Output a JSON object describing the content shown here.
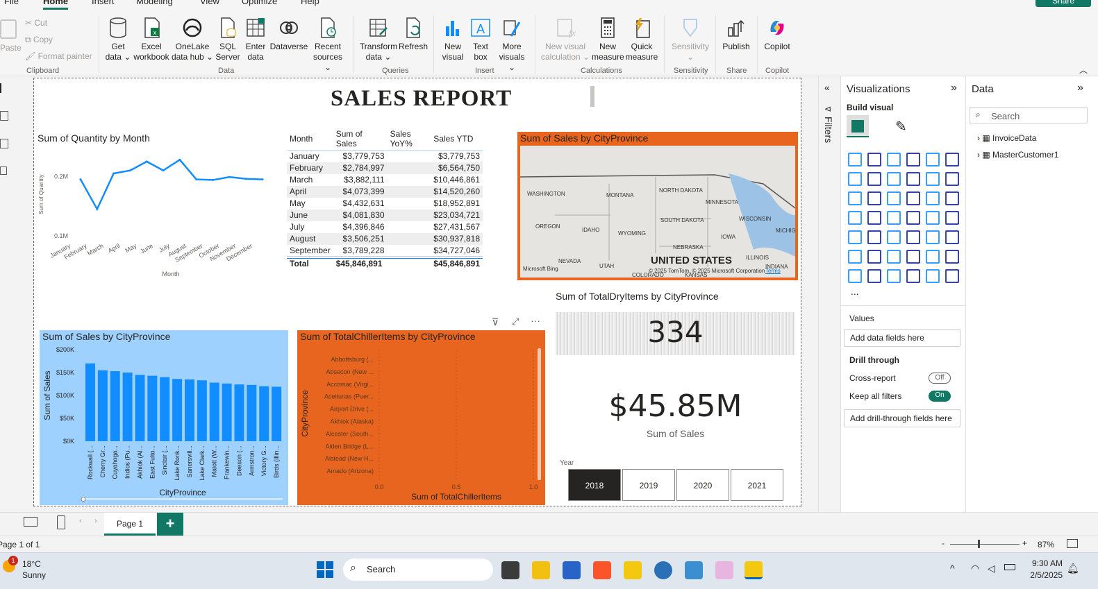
{
  "ribbon": {
    "tabs": [
      "File",
      "Home",
      "Insert",
      "Modeling",
      "View",
      "Optimize",
      "Help"
    ],
    "share": "Share",
    "clipboard": {
      "paste": "Paste",
      "cut": "Cut",
      "copy": "Copy",
      "format_painter": "Format painter",
      "group": "Clipboard"
    },
    "data_buttons": [
      {
        "l1": "Get",
        "l2": "data ⌄"
      },
      {
        "l1": "Excel",
        "l2": "workbook"
      },
      {
        "l1": "OneLake",
        "l2": "data hub ⌄"
      },
      {
        "l1": "SQL",
        "l2": "Server"
      },
      {
        "l1": "Enter",
        "l2": "data"
      },
      {
        "l1": "Dataverse",
        "l2": ""
      },
      {
        "l1": "Recent",
        "l2": "sources ⌄"
      }
    ],
    "data_group": "Data",
    "queries": [
      {
        "l1": "Transform",
        "l2": "data ⌄"
      },
      {
        "l1": "Refresh",
        "l2": ""
      }
    ],
    "queries_group": "Queries",
    "insert": [
      {
        "l1": "New",
        "l2": "visual"
      },
      {
        "l1": "Text",
        "l2": "box"
      },
      {
        "l1": "More",
        "l2": "visuals ⌄"
      }
    ],
    "insert_group": "Insert",
    "calculations": [
      {
        "l1": "New visual",
        "l2": "calculation ⌄"
      },
      {
        "l1": "New",
        "l2": "measure"
      },
      {
        "l1": "Quick",
        "l2": "measure"
      }
    ],
    "calculations_group": "Calculations",
    "sensitivity": {
      "l1": "Sensitivity",
      "l2": "⌄",
      "group": "Sensitivity"
    },
    "share_grp": {
      "l1": "Publish",
      "group": "Share"
    },
    "copilot": {
      "l1": "Copilot",
      "group": "Copilot"
    }
  },
  "report": {
    "title": "SALES REPORT",
    "line_chart_title": "Sum of Quantity by Month",
    "table": {
      "headers": [
        "Month",
        "Sum of Sales",
        "Sales YoY%",
        "Sales YTD"
      ],
      "rows": [
        [
          "January",
          "$3,779,753",
          "",
          "$3,779,753"
        ],
        [
          "February",
          "$2,784,997",
          "",
          "$6,564,750"
        ],
        [
          "March",
          "$3,882,111",
          "",
          "$10,446,861"
        ],
        [
          "April",
          "$4,073,399",
          "",
          "$14,520,260"
        ],
        [
          "May",
          "$4,432,631",
          "",
          "$18,952,891"
        ],
        [
          "June",
          "$4,081,830",
          "",
          "$23,034,721"
        ],
        [
          "July",
          "$4,396,846",
          "",
          "$27,431,567"
        ],
        [
          "August",
          "$3,506,251",
          "",
          "$30,937,818"
        ],
        [
          "September",
          "$3,789,228",
          "",
          "$34,727,046"
        ]
      ],
      "total": [
        "Total",
        "$45,846,891",
        "",
        "$45,846,891"
      ]
    },
    "map": {
      "title": "Sum of Sales by CityProvince",
      "labels": [
        "WASHINGTON",
        "MONTANA",
        "NORTH DAKOTA",
        "MINNESOTA",
        "OREGON",
        "IDAHO",
        "WYOMING",
        "SOUTH DAKOTA",
        "WISCONSIN",
        "MICHIG",
        "IOWA",
        "NEBRASKA",
        "NEVADA",
        "UTAH",
        "ILLINOIS",
        "INDIANA",
        "COLORADO",
        "KANSAS"
      ],
      "country": "UNITED STATES",
      "credit": "© 2025 TomTom, © 2025 Microsoft Corporation",
      "terms": "Terms",
      "bing": "Microsoft Bing"
    },
    "card_dry": {
      "title": "Sum of TotalDryItems by CityProvince",
      "value": "334"
    },
    "card_sales": {
      "value": "$45.85M",
      "label": "Sum of Sales"
    },
    "slicer": {
      "title": "Year",
      "options": [
        "2018",
        "2019",
        "2020",
        "2021"
      ],
      "selected": "2018"
    },
    "chiller": {
      "title": "Sum of TotalChillerItems by CityProvince",
      "ylabel": "CityProvince",
      "xlabel": "Sum of TotalChillerItems",
      "categories": [
        "Abbottsburg (...",
        "Absecon (New ...",
        "Accomac (Virgi...",
        "Aceitunas (Puer...",
        "Airport Drive (...",
        "Akhiok (Alaska)",
        "Alcester (South...",
        "Alden Bridge (L...",
        "Alstead (New H...",
        "Amado (Arizona)"
      ],
      "xticks": [
        "0.0",
        "0.5",
        "1.0"
      ]
    }
  },
  "chart_data": [
    {
      "type": "line",
      "title": "Sum of Quantity by Month",
      "xlabel": "Month",
      "ylabel": "Sum of Quantity",
      "categories": [
        "January",
        "February",
        "March",
        "April",
        "May",
        "June",
        "July",
        "August",
        "September",
        "October",
        "November",
        "December"
      ],
      "values": [
        0.195,
        0.145,
        0.205,
        0.21,
        0.225,
        0.21,
        0.228,
        0.195,
        0.194,
        0.199,
        0.196,
        0.195
      ],
      "yticks": [
        "0.2M",
        "0.1M"
      ],
      "ylim": [
        0.1,
        0.24
      ]
    },
    {
      "type": "bar",
      "title": "Sum of Sales by CityProvince",
      "xlabel": "CityProvince",
      "ylabel": "Sum of Sales",
      "categories": [
        "Rockwall (...",
        "Cherry Gr...",
        "Cuyahoga...",
        "Indios (Pu...",
        "Akhiok (Al...",
        "East Fulto...",
        "Sinclair (...",
        "Lake Ronk...",
        "Sanersvill...",
        "Lake Clark...",
        "Malott (W...",
        "Frankewin...",
        "Deeson (...",
        "Armstron...",
        "Victory G...",
        "Birds (Illin..."
      ],
      "values": [
        170000,
        155000,
        153000,
        150000,
        145000,
        143000,
        140000,
        136000,
        135000,
        133000,
        128000,
        126000,
        124000,
        123000,
        120000,
        119000
      ],
      "yticks": [
        "$200K",
        "$150K",
        "$100K",
        "$50K",
        "$0K"
      ],
      "ylim": [
        0,
        200000
      ],
      "color": "#118dff"
    }
  ],
  "viz_pane": {
    "title": "Visualizations",
    "build": "Build visual",
    "values": "Values",
    "values_well": "Add data fields here",
    "drill": "Drill through",
    "cross": "Cross-report",
    "cross_state": "Off",
    "keep": "Keep all filters",
    "keep_state": "On",
    "drill_well": "Add drill-through fields here",
    "more": "..."
  },
  "filters_label": "Filters",
  "data_pane": {
    "title": "Data",
    "search": "Search",
    "tables": [
      "InvoiceData",
      "MasterCustomer1"
    ]
  },
  "pages": {
    "current": "Page 1",
    "add": "+"
  },
  "status": {
    "page": "Page 1 of 1",
    "zoom": "87%",
    "minus": "-",
    "plus": "+"
  },
  "taskbar": {
    "temp": "18°C",
    "weather": "Sunny",
    "badge": "1",
    "search": "Search",
    "time": "9:30 AM",
    "date": "2/5/2025"
  }
}
